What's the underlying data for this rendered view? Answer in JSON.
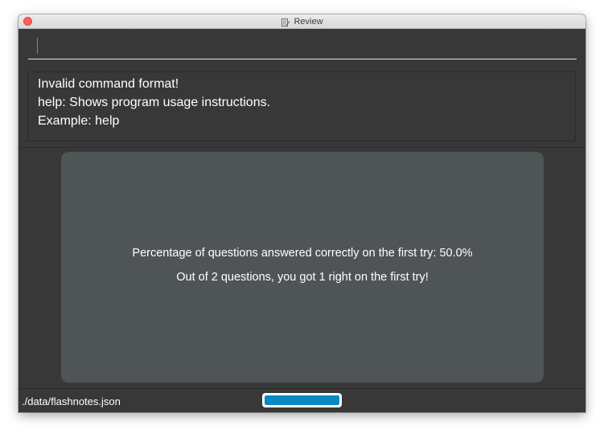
{
  "window": {
    "title": "Review"
  },
  "command_box": {
    "value": ""
  },
  "result_display": {
    "lines": [
      "Invalid command format!",
      "help: Shows program usage instructions.",
      "Example: help"
    ]
  },
  "review_stats": {
    "percentage_line": "Percentage of questions answered correctly on the first try: 50.0%",
    "summary_line": "Out of 2 questions, you got 1 right on the first try!"
  },
  "status_bar": {
    "file_path": "./data/flashnotes.json",
    "progress": 1.0
  },
  "colors": {
    "background": "#383838",
    "card": "#4f5456",
    "progress_fill": "#0a8ac0",
    "close_button": "#ff5f57"
  },
  "icons": {
    "title_icon": "document-edit-icon",
    "close": "close-button"
  }
}
